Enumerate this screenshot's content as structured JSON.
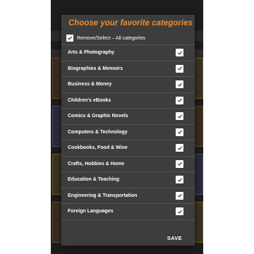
{
  "dialog": {
    "title": "Choose your favorite categories",
    "select_all_label": "Remove/Select – All categories",
    "select_all_checked": true,
    "save_label": "SAVE"
  },
  "categories": [
    {
      "label": "Arts & Photography",
      "checked": true
    },
    {
      "label": "Biographies & Memoirs",
      "checked": true
    },
    {
      "label": "Business & Money",
      "checked": true
    },
    {
      "label": "Children's eBooks",
      "checked": true
    },
    {
      "label": "Comics & Graphic Novels",
      "checked": true
    },
    {
      "label": "Computers & Technology",
      "checked": true
    },
    {
      "label": "Cookbooks, Food & Wine",
      "checked": true
    },
    {
      "label": "Crafts, Hobbies & Home",
      "checked": true
    },
    {
      "label": "Education & Teaching",
      "checked": true
    },
    {
      "label": "Engineering & Transportation",
      "checked": true
    },
    {
      "label": "Foreign Languages",
      "checked": true
    }
  ],
  "colors": {
    "title": "#f08a2a",
    "dialog_bg": "#3d3d3d",
    "divider": "#555555",
    "checkbox": "#ffffff",
    "checkmark": "#3d3d3d"
  },
  "icons": {
    "checkbox": "checkbox-checked-icon"
  }
}
